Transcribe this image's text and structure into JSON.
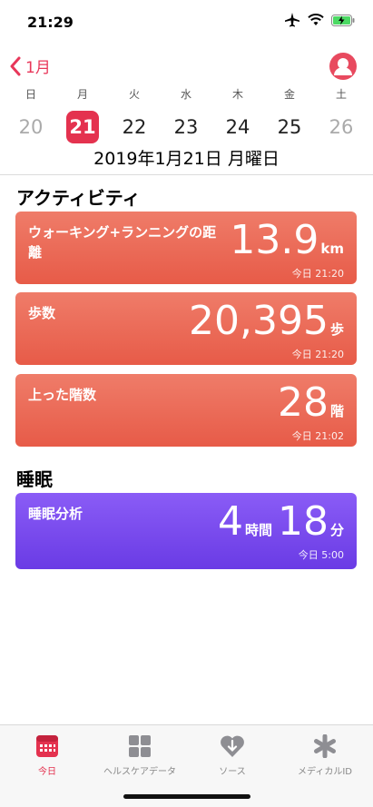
{
  "status_bar": {
    "time": "21:29"
  },
  "header": {
    "back_label": "1月"
  },
  "week": {
    "weekdays": [
      "日",
      "月",
      "火",
      "水",
      "木",
      "金",
      "土"
    ],
    "dates": [
      "20",
      "21",
      "22",
      "23",
      "24",
      "25",
      "26"
    ],
    "full_date": "2019年1月21日 月曜日"
  },
  "activity": {
    "title": "アクティビティ",
    "cards": [
      {
        "label": "ウォーキング+ランニングの距離",
        "value": "13.9",
        "unit": "km",
        "time": "今日 21:20"
      },
      {
        "label": "歩数",
        "value": "20,395",
        "unit": "歩",
        "time": "今日 21:20"
      },
      {
        "label": "上った階数",
        "value": "28",
        "unit": "階",
        "time": "今日 21:02"
      }
    ]
  },
  "sleep": {
    "title": "睡眠",
    "card": {
      "label": "睡眠分析",
      "hours": "4",
      "hours_unit": "時間",
      "minutes": "18",
      "minutes_unit": "分",
      "time": "今日 5:00"
    }
  },
  "tabs": [
    {
      "label": "今日",
      "icon": "today-calendar-icon"
    },
    {
      "label": "ヘルスケアデータ",
      "icon": "grid-icon"
    },
    {
      "label": "ソース",
      "icon": "source-heart-icon"
    },
    {
      "label": "メディカルID",
      "icon": "asterisk-icon"
    }
  ],
  "colors": {
    "accent": "#e4324f",
    "activity": "#ea6652",
    "sleep": "#7847ef"
  }
}
